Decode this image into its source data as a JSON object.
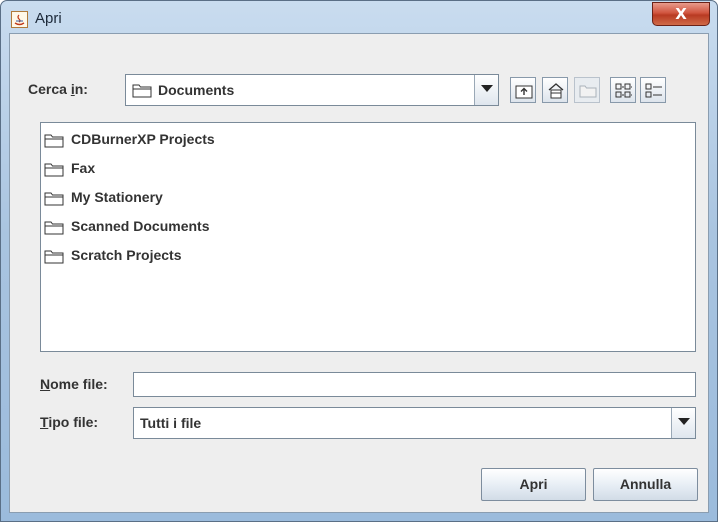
{
  "window": {
    "title": "Apri",
    "close_label": "X"
  },
  "look_in": {
    "label_pre": "Cerca ",
    "label_mnemonic": "i",
    "label_post": "n:",
    "value": "Documents"
  },
  "toolbar": {
    "icons": [
      "up-folder-icon",
      "home-icon",
      "new-folder-icon",
      "list-view-icon",
      "details-view-icon"
    ]
  },
  "files": [
    {
      "name": "CDBurnerXP Projects",
      "icon": "folder-icon"
    },
    {
      "name": "Fax",
      "icon": "folder-icon"
    },
    {
      "name": "My Stationery",
      "icon": "folder-icon"
    },
    {
      "name": "Scanned Documents",
      "icon": "folder-icon"
    },
    {
      "name": "Scratch Projects",
      "icon": "folder-icon"
    }
  ],
  "file_name": {
    "label_mnemonic": "N",
    "label_rest": "ome file:",
    "value": ""
  },
  "file_type": {
    "label_mnemonic": "T",
    "label_rest": "ipo file:",
    "value": "Tutti i file"
  },
  "buttons": {
    "open": "Apri",
    "cancel": "Annulla"
  }
}
